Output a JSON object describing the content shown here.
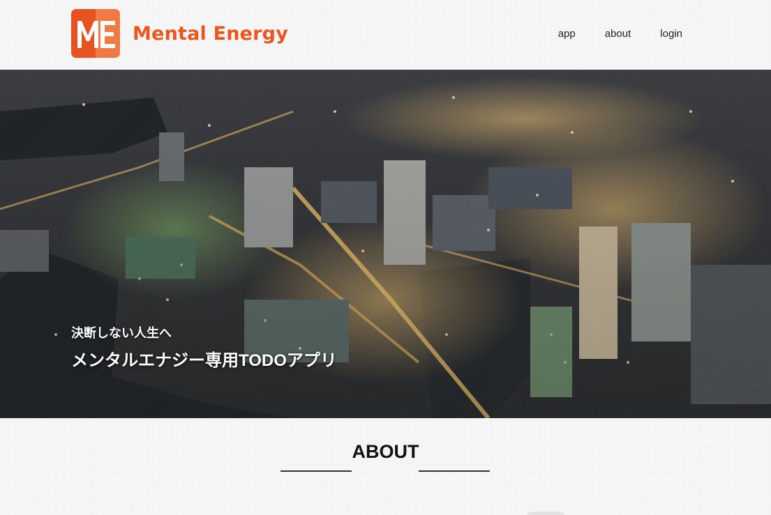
{
  "header": {
    "logo_mark": "ME",
    "logo_text": "Mental Energy",
    "nav": [
      {
        "label": "app"
      },
      {
        "label": "about"
      },
      {
        "label": "login"
      }
    ]
  },
  "hero": {
    "subtitle": "決断しない人生へ",
    "title": "メンタルエナジー専用TODOアプリ"
  },
  "about": {
    "title": "ABOUT"
  },
  "colors": {
    "brand": "#e9571f",
    "brand_light": "#f07a45"
  }
}
